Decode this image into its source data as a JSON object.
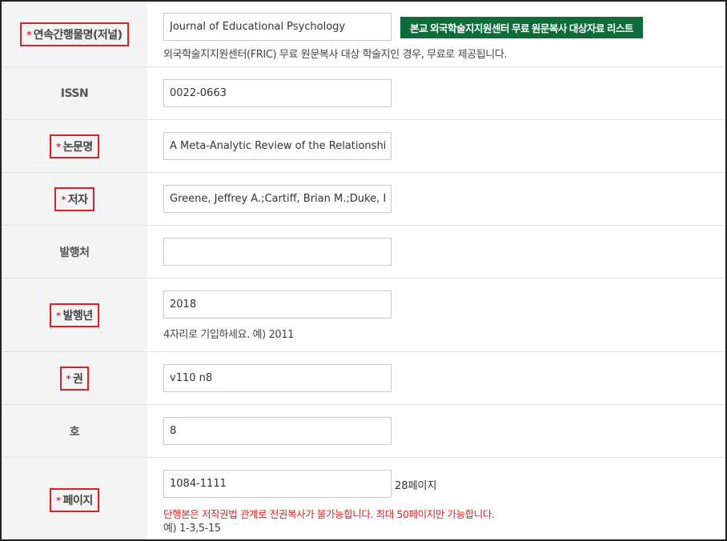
{
  "fields": {
    "journal": {
      "label": "연속간행물명(저널)",
      "value": "Journal of Educational Psychology",
      "button": "본교 외국학술지지원센터 무료 원문복사 대상자료 리스트",
      "note": "외국학술지지원센터(FRIC) 무료 원문복사 대상 학술지인 경우, 무료로 제공됩니다."
    },
    "issn": {
      "label": "ISSN",
      "value": "0022-0663"
    },
    "title": {
      "label": "논문명",
      "value": "A Meta-Analytic Review of the Relationship between"
    },
    "author": {
      "label": "저자",
      "value": "Greene, Jeffrey A.;Cartiff, Brian M.;Duke, Rebecca F."
    },
    "publisher": {
      "label": "발행처",
      "value": ""
    },
    "year": {
      "label": "발행년",
      "value": "2018",
      "note": "4자리로 기입하세요. 예) 2011"
    },
    "volume": {
      "label": "권",
      "value": "v110 n8"
    },
    "issue": {
      "label": "호",
      "value": "8"
    },
    "pages": {
      "label": "페이지",
      "value": "1084-1111",
      "suffix": "28페이지",
      "warning": "단행본은 저작권법 관계로 전권복사가 불가능합니다. 최대 50페이지만 가능합니다.",
      "example": "예) 1-3,5-15"
    }
  },
  "required_mark": "*",
  "colors": {
    "accent_green": "#0e6b3a",
    "required_red": "#e01e27"
  }
}
